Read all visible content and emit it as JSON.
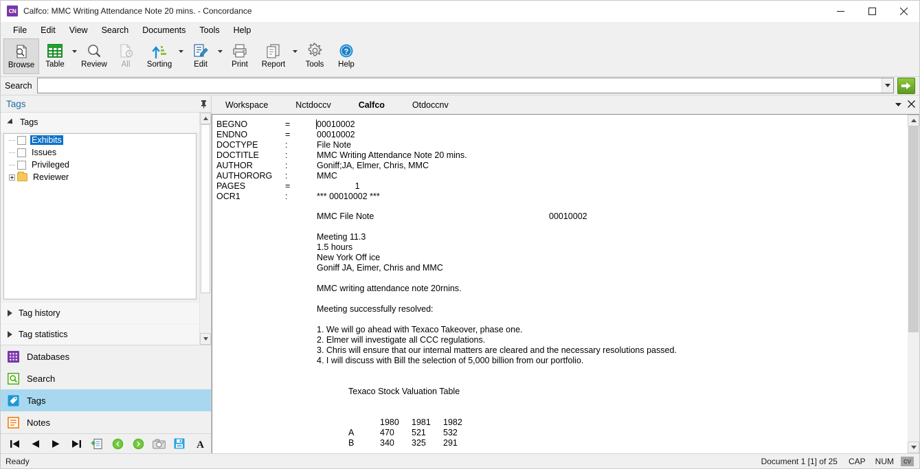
{
  "window": {
    "app_icon_text": "CN",
    "title": "Calfco: MMC Writing Attendance Note 20 mins. - Concordance",
    "minimize": "—",
    "maximize": "□",
    "close": "✕"
  },
  "menubar": {
    "items": [
      {
        "label": "File"
      },
      {
        "label": "Edit"
      },
      {
        "label": "View"
      },
      {
        "label": "Search"
      },
      {
        "label": "Documents"
      },
      {
        "label": "Tools"
      },
      {
        "label": "Help"
      }
    ]
  },
  "toolbar": {
    "buttons": [
      {
        "label": "Browse",
        "icon": "browse-icon",
        "active": true,
        "dropdown": false,
        "disabled": false
      },
      {
        "label": "Table",
        "icon": "table-icon",
        "active": false,
        "dropdown": true,
        "disabled": false
      },
      {
        "label": "Review",
        "icon": "review-icon",
        "active": false,
        "dropdown": false,
        "disabled": false
      },
      {
        "label": "All",
        "icon": "all-icon",
        "active": false,
        "dropdown": false,
        "disabled": true
      },
      {
        "label": "Sorting",
        "icon": "sorting-icon",
        "active": false,
        "dropdown": true,
        "disabled": false
      },
      {
        "label": "Edit",
        "icon": "edit-icon",
        "active": false,
        "dropdown": true,
        "disabled": false
      },
      {
        "label": "Print",
        "icon": "print-icon",
        "active": false,
        "dropdown": false,
        "disabled": false
      },
      {
        "label": "Report",
        "icon": "report-icon",
        "active": false,
        "dropdown": true,
        "disabled": false
      },
      {
        "label": "Tools",
        "icon": "gear-icon",
        "active": false,
        "dropdown": false,
        "disabled": false
      },
      {
        "label": "Help",
        "icon": "help-icon",
        "active": false,
        "dropdown": false,
        "disabled": false
      }
    ]
  },
  "search": {
    "label": "Search",
    "value": "",
    "placeholder": "",
    "dropdown_icon": "chevron-down-icon",
    "go_icon": "arrow-right-icon"
  },
  "left_panel": {
    "title": "Tags",
    "pin_icon": "pin-icon",
    "section": {
      "label": "Tags",
      "expanded": true
    },
    "tree": [
      {
        "label": "Exhibits",
        "type": "checkbox",
        "selected": true
      },
      {
        "label": "Issues",
        "type": "checkbox",
        "selected": false
      },
      {
        "label": "Privileged",
        "type": "checkbox",
        "selected": false
      },
      {
        "label": "Reviewer",
        "type": "folder",
        "selected": false,
        "expandable": true
      }
    ],
    "collapsed_sections": [
      {
        "label": "Tag history"
      },
      {
        "label": "Tag statistics"
      }
    ],
    "nav": [
      {
        "label": "Databases",
        "icon": "databases-icon",
        "color": "#7b35a8",
        "selected": false
      },
      {
        "label": "Search",
        "icon": "search-icon",
        "color": "#4caf16",
        "selected": false
      },
      {
        "label": "Tags",
        "icon": "tag-icon",
        "color": "#0d8ed8",
        "selected": true
      },
      {
        "label": "Notes",
        "icon": "notes-icon",
        "color": "#f08a24",
        "selected": false
      }
    ],
    "bottom_toolbar": [
      {
        "icon": "first-record-icon",
        "name": "first-record-button"
      },
      {
        "icon": "previous-record-icon",
        "name": "previous-record-button"
      },
      {
        "icon": "next-record-icon",
        "name": "next-record-button"
      },
      {
        "icon": "last-record-icon",
        "name": "last-record-button"
      },
      {
        "icon": "add-document-icon",
        "name": "add-document-button"
      },
      {
        "icon": "back-icon",
        "name": "back-button"
      },
      {
        "icon": "forward-icon",
        "name": "forward-button"
      },
      {
        "icon": "camera-icon",
        "name": "snapshot-button"
      },
      {
        "icon": "save-icon",
        "name": "save-button"
      },
      {
        "icon": "font-icon",
        "name": "font-button"
      }
    ]
  },
  "tabs": [
    {
      "label": "Workspace",
      "active": false
    },
    {
      "label": "Nctdoccv",
      "active": false
    },
    {
      "label": "Calfco",
      "active": true
    },
    {
      "label": "Otdoccnv",
      "active": false
    }
  ],
  "tabstrip_controls": {
    "overflow_icon": "chevron-down-icon",
    "close_icon": "close-icon"
  },
  "document": {
    "fields": [
      {
        "name": "BEGNO",
        "sep": "=",
        "value": "00010002",
        "caret": true
      },
      {
        "name": "ENDNO",
        "sep": "=",
        "value": "00010002",
        "caret": false
      },
      {
        "name": "DOCTYPE",
        "sep": ":",
        "value": "File Note",
        "caret": false
      },
      {
        "name": "DOCTITLE",
        "sep": ":",
        "value": "MMC Writing Attendance Note 20 mins.",
        "caret": false
      },
      {
        "name": "AUTHOR",
        "sep": ":",
        "value": "Goniff;JA, Elmer, Chris, MMC",
        "caret": false
      },
      {
        "name": "AUTHORORG",
        "sep": ":",
        "value": "MMC",
        "caret": false
      },
      {
        "name": "PAGES",
        "sep": "=",
        "value": "                1",
        "caret": false
      },
      {
        "name": "OCR1",
        "sep": ":",
        "value": "*** 00010002 ***",
        "caret": false
      }
    ],
    "ocr_header": {
      "left": "MMC File Note",
      "right": "00010002"
    },
    "ocr_lines": [
      "Meeting 11.3",
      "1.5 hours",
      "New York Off ice",
      "Goniff JA, Eimer, Chris and MMC"
    ],
    "ocr_body": [
      "MMC writing attendance note 20rnins."
    ],
    "ocr_resolution_header": "Meeting successfully resolved:",
    "ocr_items": [
      "1. We will go ahead with Texaco Takeover, phase one.",
      "2. Elmer will investigate all CCC regulations.",
      "3. Chris will ensure that our internal matters are cleared and the necessary resolutions passed.",
      "4. I will discuss with Bill the selection of 5,000 billion from our portfolio."
    ],
    "table": {
      "title": "Texaco Stock Valuation Table",
      "columns": [
        "1980",
        "1981",
        "1982"
      ],
      "rows": [
        {
          "label": "A",
          "values": [
            "470",
            "521",
            "532"
          ]
        },
        {
          "label": "B",
          "values": [
            "340",
            "325",
            "291"
          ]
        }
      ]
    }
  },
  "statusbar": {
    "ready": "Ready",
    "document_position": "Document 1 [1] of 25",
    "cap": "CAP",
    "num": "NUM",
    "cv": "cv"
  }
}
